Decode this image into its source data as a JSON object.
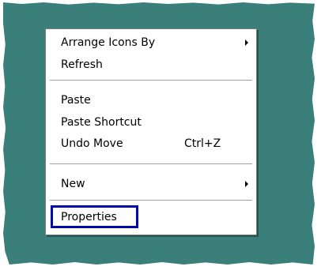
{
  "context_menu": {
    "items": [
      {
        "label": "Arrange Icons By",
        "has_submenu": true
      },
      {
        "label": "Refresh"
      },
      {
        "label": "Paste"
      },
      {
        "label": "Paste Shortcut"
      },
      {
        "label": "Undo Move",
        "shortcut": "Ctrl+Z"
      },
      {
        "label": "New",
        "has_submenu": true
      },
      {
        "label": "Properties",
        "highlighted": true
      }
    ]
  },
  "colors": {
    "desktop_background": "#3a7f7a",
    "menu_background": "#ffffff",
    "highlight_border": "#000aa8"
  }
}
